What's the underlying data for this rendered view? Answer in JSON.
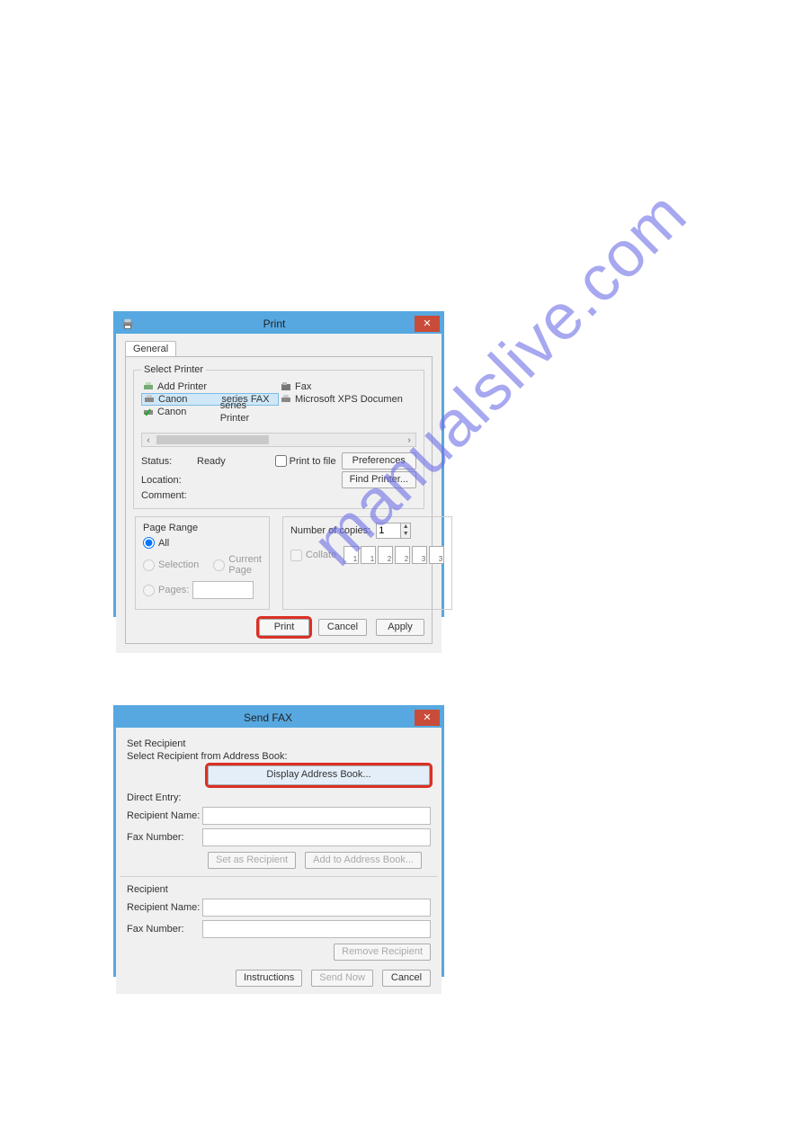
{
  "watermark_text": "manualslive.com",
  "print_dialog": {
    "title": "Print",
    "tab_general": "General",
    "select_printer_legend": "Select Printer",
    "printers": {
      "add_printer": "Add Printer",
      "fax": "Fax",
      "canon_fax_prefix": "Canon",
      "canon_fax_suffix": "series FAX",
      "ms_xps": "Microsoft XPS Documen",
      "canon_printer_prefix": "Canon",
      "canon_printer_suffix": "series Printer"
    },
    "status_label": "Status:",
    "status_value": "Ready",
    "location_label": "Location:",
    "comment_label": "Comment:",
    "print_to_file_label": "Print to file",
    "preferences_btn": "Preferences",
    "find_printer_btn": "Find Printer...",
    "page_range_legend": "Page Range",
    "radio_all": "All",
    "radio_selection": "Selection",
    "radio_current": "Current Page",
    "radio_pages": "Pages:",
    "copies_label": "Number of copies:",
    "copies_value": "1",
    "collate_label": "Collate",
    "collate_pages": [
      "1",
      "1",
      "2",
      "2",
      "3",
      "3"
    ],
    "btn_print": "Print",
    "btn_cancel": "Cancel",
    "btn_apply": "Apply"
  },
  "fax_dialog": {
    "title": "Send FAX",
    "set_recipient_label": "Set Recipient",
    "select_from_ab_label": "Select Recipient from Address Book:",
    "display_ab_btn": "Display Address Book...",
    "direct_entry_label": "Direct Entry:",
    "recipient_name_label": "Recipient Name:",
    "fax_number_label": "Fax Number:",
    "set_as_recipient_btn": "Set as Recipient",
    "add_to_ab_btn": "Add to Address Book...",
    "recipient_section_label": "Recipient",
    "remove_recipient_btn": "Remove Recipient",
    "instructions_btn": "Instructions",
    "send_now_btn": "Send Now",
    "cancel_btn": "Cancel"
  }
}
